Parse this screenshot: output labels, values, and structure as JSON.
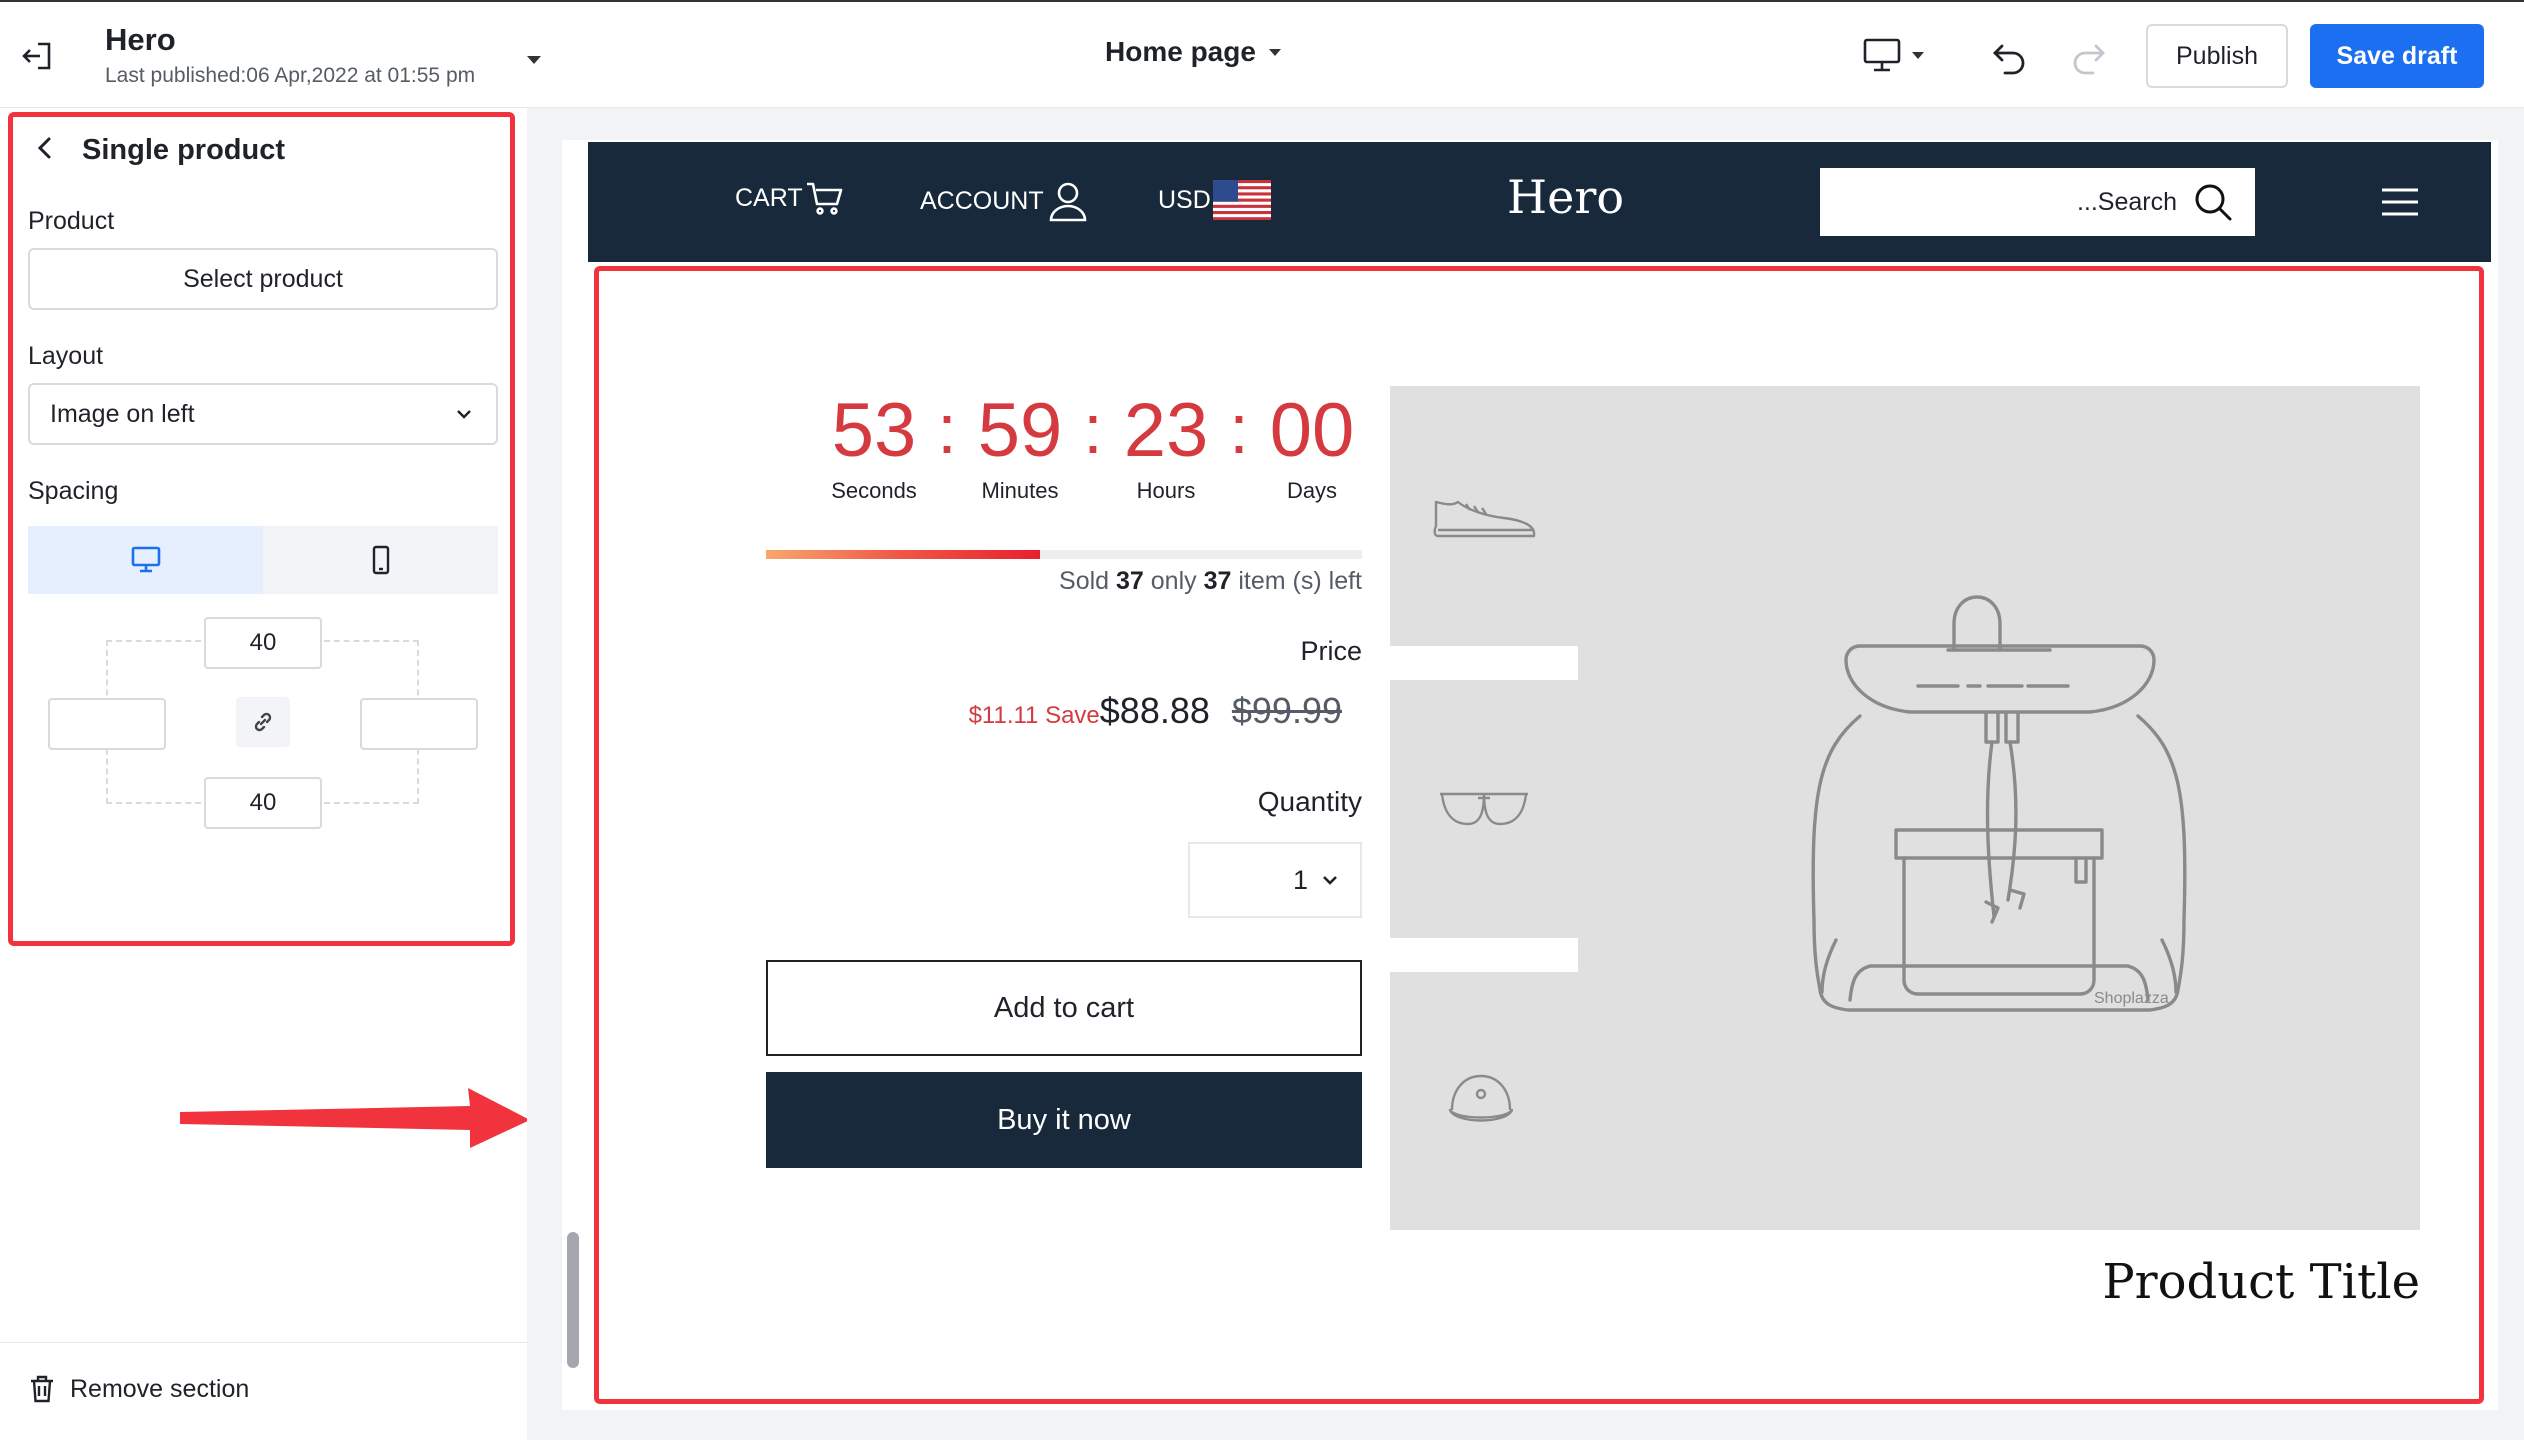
{
  "topbar": {
    "app_title": "Hero",
    "last_published": "Last published:06 Apr,2022 at 01:55 pm",
    "page_select": "Home page",
    "publish_label": "Publish",
    "save_draft_label": "Save draft"
  },
  "sidebar": {
    "section_title": "Single product",
    "product_label": "Product",
    "select_product_label": "Select product",
    "layout_label": "Layout",
    "layout_value": "Image on left",
    "spacing_label": "Spacing",
    "spacing_top": "40",
    "spacing_bottom": "40",
    "spacing_left": "",
    "spacing_right": "",
    "remove_section_label": "Remove section"
  },
  "store": {
    "cart_label": "CART",
    "account_label": "ACCOUNT",
    "currency_label": "USD",
    "logo": "Hero",
    "search_text": "...Search"
  },
  "product": {
    "countdown": [
      {
        "value": "53",
        "label": "Seconds"
      },
      {
        "value": "59",
        "label": "Minutes"
      },
      {
        "value": "23",
        "label": "Hours"
      },
      {
        "value": "00",
        "label": "Days"
      }
    ],
    "countdown_separator": ":",
    "sold_progress": 0.46,
    "sold_word": "Sold",
    "sold_count": "37",
    "only_word": "only",
    "remaining_count": "37",
    "item_suffix": "item (s) left",
    "price_label": "Price",
    "save_text": "$11.11 Save",
    "sale_price": "$88.88",
    "original_price": "$99.99",
    "quantity_label": "Quantity",
    "quantity_value": "1",
    "add_to_cart_label": "Add to cart",
    "buy_now_label": "Buy it now",
    "image_watermark": "Shoplazza",
    "title": "Product Title"
  },
  "colors": {
    "highlight": "#f0333d",
    "primary": "#1d6ff2",
    "store_header": "#17293a",
    "countdown": "#d43a3f",
    "image_bg": "#e0e0e0"
  },
  "icons": {
    "exit": "exit-icon",
    "undo": "undo-icon",
    "redo": "redo-icon",
    "device": "desktop-icon",
    "back": "chevron-left-icon",
    "link": "link-icon",
    "trash": "trash-icon",
    "cart": "cart-icon",
    "account": "user-icon",
    "flag": "us-flag-icon",
    "search": "search-icon",
    "menu": "menu-icon"
  }
}
